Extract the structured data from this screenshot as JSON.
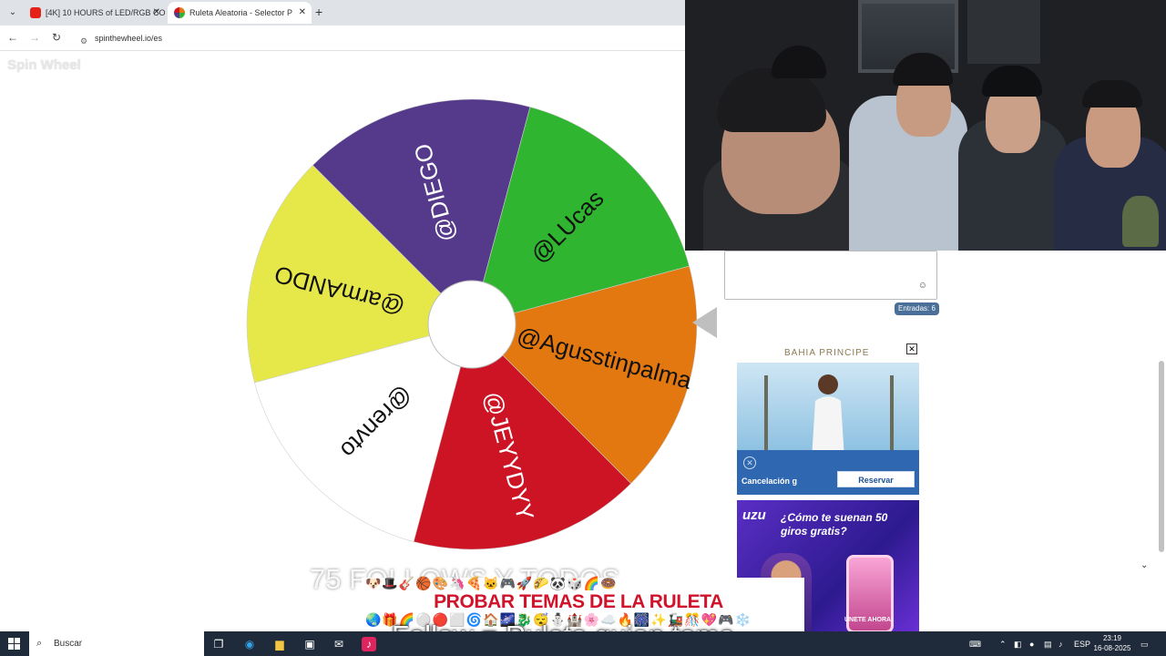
{
  "browser": {
    "tabs": [
      {
        "title": "[4K] 10 HOURS of LED/RGB CO",
        "favicon_color": "#e62117"
      },
      {
        "title": "Ruleta Aleatoria - Selector P",
        "favicon_color": "#f4b400"
      }
    ],
    "new_tab": "+",
    "url": "spinthewheel.io/es"
  },
  "site": {
    "logo": "Spin Wheel",
    "entries_badge": "Entradas: 6",
    "emoji_button": "☺"
  },
  "wheel": {
    "segments": [
      {
        "label": "@Agusstinpalma",
        "color": "#e2780f",
        "text_color": "#111111"
      },
      {
        "label": "@JEYYDYY",
        "color": "#cc1424",
        "text_color": "#ffffff"
      },
      {
        "label": "@renvto",
        "color": "#ffffff",
        "text_color": "#111111"
      },
      {
        "label": "@armANDO",
        "color": "#e6e84a",
        "text_color": "#111111"
      },
      {
        "label": "@DIEGO",
        "color": "#553a8c",
        "text_color": "#ffffff"
      },
      {
        "label": "@LUcas",
        "color": "#2fb52f",
        "text_color": "#111111"
      }
    ]
  },
  "ads": {
    "hotel": {
      "brand": "BAHIA PRINCIPE",
      "cancel_text": "Cancelación g",
      "cta": "Reservar"
    },
    "casino": {
      "brand": "uzu",
      "headline": "¿Cómo te suenan 50 giros gratis?",
      "cta": "ÚNETE AHORA"
    }
  },
  "overlay": {
    "caption_top": "75 FOLLOWS Y TODOS",
    "banner_title": "PROBAR TEMAS DE LA RULETA",
    "banner_icons_row1": "🐶🎩🎸🏀🎨🦄🍕🐱🎮🚀🌮🐼🎲🌈🍩",
    "banner_icons_row2": "🌏🎁🌈⚪🔴⬜🌀🏠🌌🐉😴⛄🏰🌸☁️🔥🎆✨🚂🎊💖🎮❄️",
    "caption_bottom": "Follow = Ruleta,quien toma"
  },
  "taskbar": {
    "search_placeholder": "Buscar",
    "language": "ESP",
    "time": "23:19",
    "date": "16-08-2025"
  }
}
